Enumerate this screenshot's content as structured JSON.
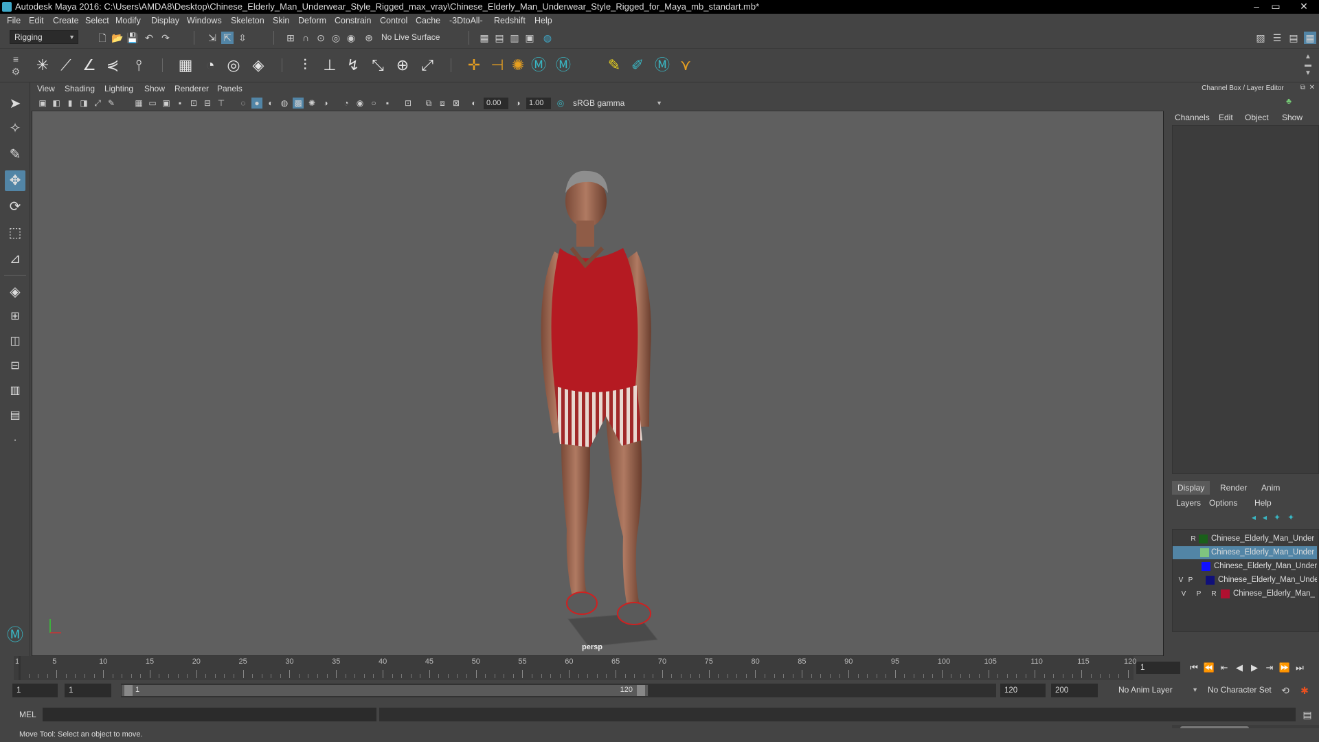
{
  "window": {
    "title": "Autodesk Maya 2016: C:\\Users\\AMDA8\\Desktop\\Chinese_Elderly_Man_Underwear_Style_Rigged_max_vray\\Chinese_Elderly_Man_Underwear_Style_Rigged_for_Maya_mb_standart.mb*",
    "minimize": "–",
    "maximize": "▭",
    "close": "✕"
  },
  "menu": [
    "File",
    "Edit",
    "Create",
    "Select",
    "Modify",
    "Display",
    "Windows",
    "Skeleton",
    "Skin",
    "Deform",
    "Constrain",
    "Control",
    "Cache",
    "-3DtoAll-",
    "Redshift",
    "Help"
  ],
  "statusline": {
    "menu_set": "Rigging",
    "live_surface": "No Live Surface"
  },
  "panel": {
    "menu": [
      "View",
      "Shading",
      "Lighting",
      "Show",
      "Renderer",
      "Panels"
    ],
    "exposure": "0.00",
    "gamma": "1.00",
    "color_space": "sRGB gamma",
    "camera_label": "persp"
  },
  "channel_box": {
    "title": "Channel Box / Layer Editor",
    "tabs": [
      "Channels",
      "Edit",
      "Object",
      "Show"
    ]
  },
  "layer_editor": {
    "tabs": [
      "Display",
      "Render",
      "Anim"
    ],
    "active_tab": "Display",
    "menu": [
      "Layers",
      "Options",
      "Help"
    ],
    "layers": [
      {
        "v": "",
        "p": "",
        "r": "R",
        "color": "#1a5f1a",
        "name": "Chinese_Elderly_Man_Under",
        "selected": false
      },
      {
        "v": "",
        "p": "",
        "r": "",
        "color": "#7fc47f",
        "name": "Chinese_Elderly_Man_Under",
        "selected": true
      },
      {
        "v": "",
        "p": "",
        "r": "",
        "color": "#1010ff",
        "name": "Chinese_Elderly_Man_Under",
        "selected": false
      },
      {
        "v": "V",
        "p": "P",
        "r": "",
        "color": "#10107a",
        "name": "Chinese_Elderly_Man_Unde",
        "selected": false
      },
      {
        "v": "V",
        "p": "P",
        "r": "R",
        "color": "#b01030",
        "name": "Chinese_Elderly_Man_",
        "selected": false
      }
    ]
  },
  "timeline": {
    "ticks": [
      1,
      5,
      10,
      15,
      20,
      25,
      30,
      35,
      40,
      45,
      50,
      55,
      60,
      65,
      70,
      75,
      80,
      85,
      90,
      95,
      100,
      105,
      110,
      115,
      120
    ],
    "current_frame": "1"
  },
  "range": {
    "start": "1",
    "playback_start": "1",
    "range_start_label": "1",
    "range_end_label": "120",
    "playback_end": "120",
    "end": "200",
    "anim_layer": "No Anim Layer",
    "character_set": "No Character Set"
  },
  "command_line": {
    "language": "MEL"
  },
  "help_line": "Move Tool: Select an object to move."
}
